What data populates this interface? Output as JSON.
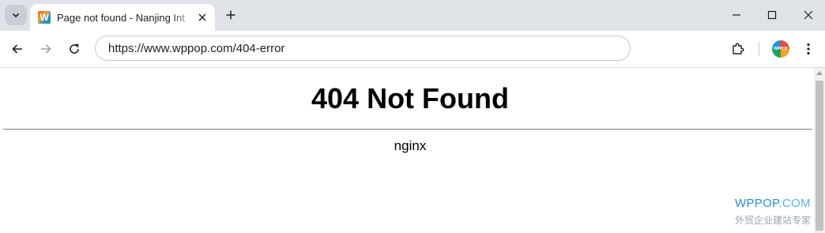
{
  "tab": {
    "favicon_letter": "W",
    "title": "Page not found - Nanjing Int"
  },
  "toolbar": {
    "url": "https://www.wppop.com/404-error",
    "avatar_text": "WPPOP"
  },
  "page": {
    "heading": "404 Not Found",
    "server": "nginx"
  },
  "watermark": {
    "brand": "WPPOP",
    "brand_suffix": ".COM",
    "tagline": "外贸企业建站专家"
  },
  "icons": {
    "tab_search": "chevron-down-icon",
    "tab_close": "close-icon",
    "new_tab": "plus-icon",
    "minimize": "minimize-icon",
    "maximize": "maximize-icon",
    "close_window": "close-icon",
    "back": "arrow-left-icon",
    "forward": "arrow-right-icon",
    "reload": "reload-icon",
    "extensions": "puzzle-icon",
    "menu": "kebab-menu-icon"
  }
}
